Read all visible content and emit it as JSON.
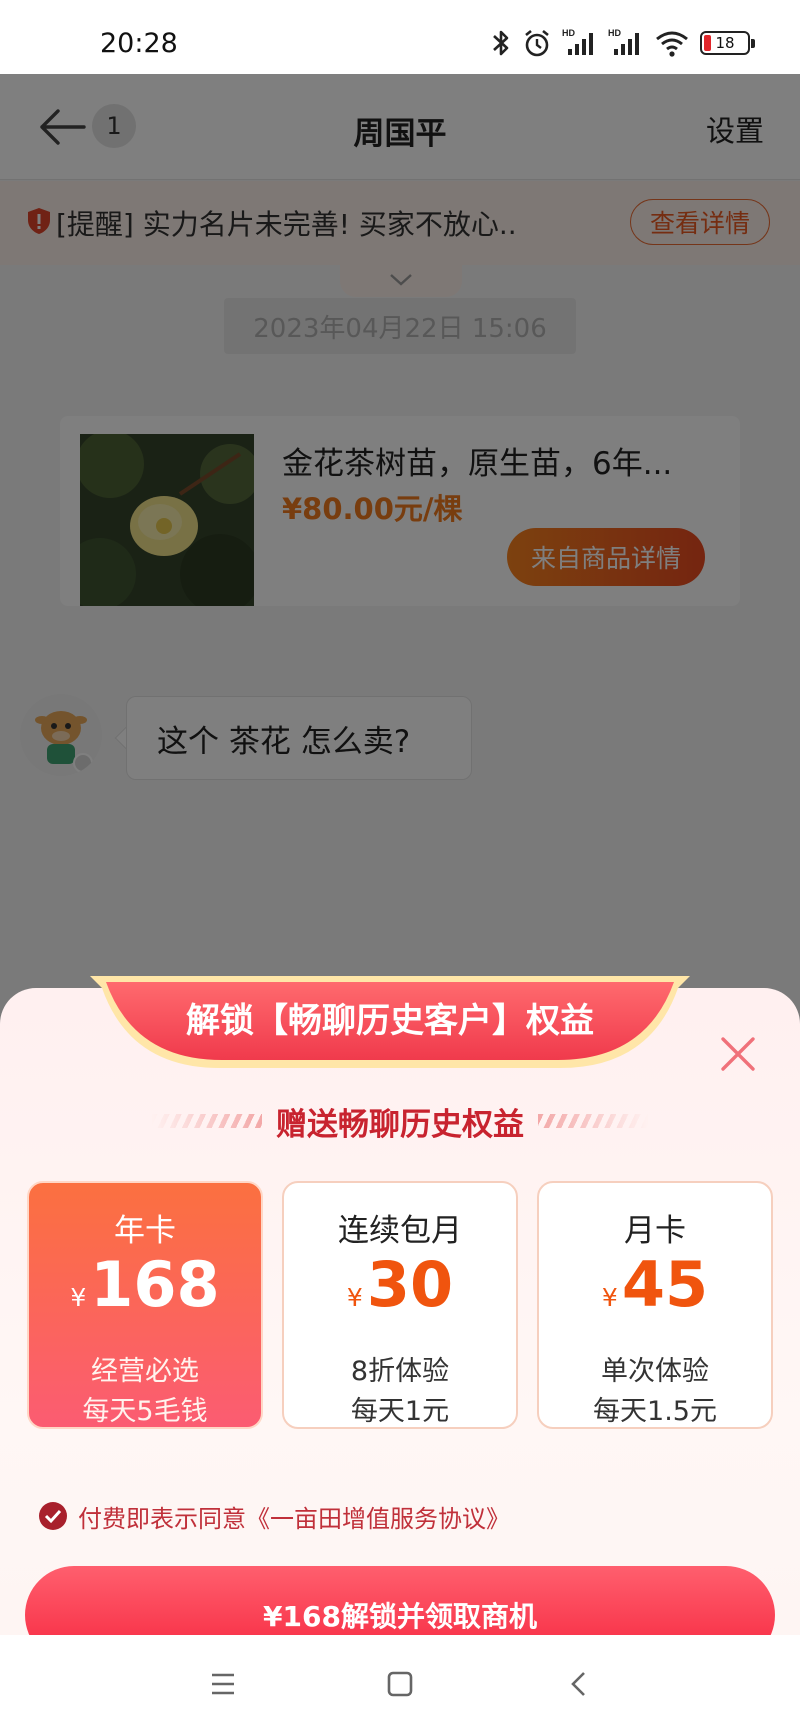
{
  "status_bar": {
    "time": "20:28",
    "battery": "18"
  },
  "header": {
    "badge_count": "1",
    "title": "周国平",
    "settings": "设置"
  },
  "reminder": {
    "text": "[提醒] 实力名片未完善! 买家不放心..",
    "button": "查看详情"
  },
  "chat": {
    "timestamp": "2023年04月22日 15:06",
    "product": {
      "name": "金花茶树苗，原生苗，6年...",
      "price": "¥80.00元/棵",
      "source_button": "来自商品详情"
    },
    "message": "这个 茶花 怎么卖?"
  },
  "sheet": {
    "banner": "解锁【畅聊历史客户】权益",
    "subtitle": "赠送畅聊历史权益",
    "plans": [
      {
        "name": "年卡",
        "currency": "¥",
        "amount": "168",
        "line1": "经营必选",
        "line2": "每天5毛钱",
        "selected": true
      },
      {
        "name": "连续包月",
        "currency": "¥",
        "amount": "30",
        "line1": "8折体验",
        "line2": "每天1元",
        "selected": false
      },
      {
        "name": "月卡",
        "currency": "¥",
        "amount": "45",
        "line1": "单次体验",
        "line2": "每天1.5元",
        "selected": false
      }
    ],
    "agreement": "付费即表示同意《一亩田增值服务协议》",
    "pay_button": "¥168解锁并领取商机"
  },
  "colors": {
    "accent": "#f6273f",
    "orange": "#f0540e",
    "agree": "#c0303a",
    "reminder_bg": "#fdf1ea"
  }
}
